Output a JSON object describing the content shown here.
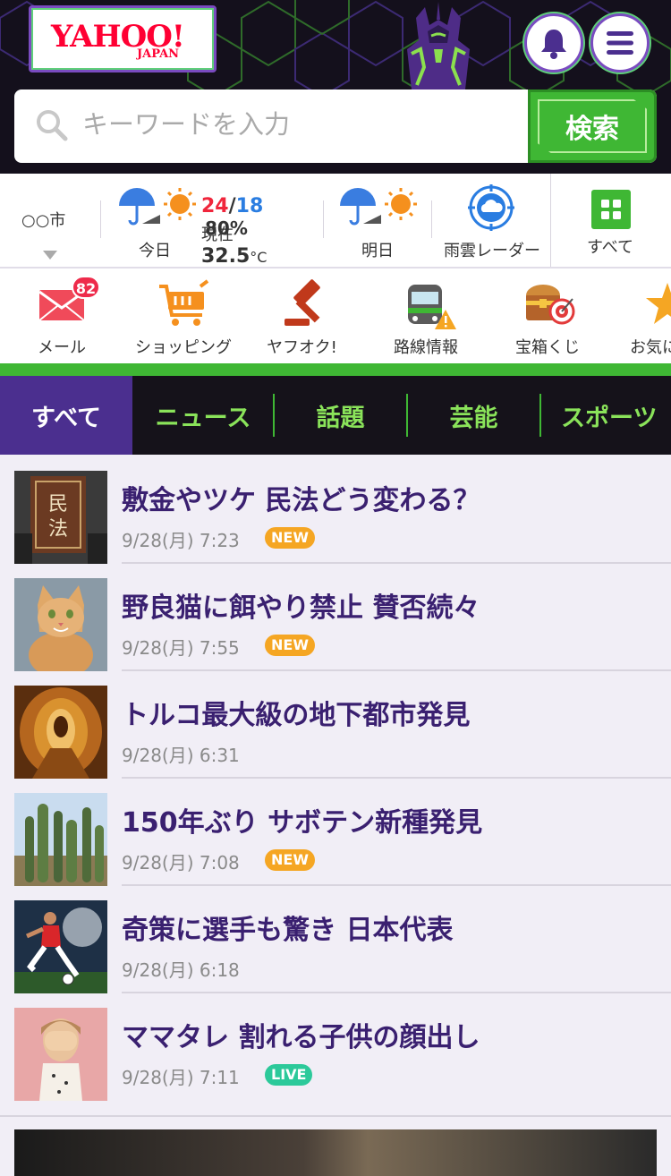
{
  "header": {
    "logo_text": "YAHOO!",
    "logo_sub": "JAPAN",
    "search": {
      "placeholder": "キーワードを入力",
      "button": "検索"
    },
    "colors": {
      "accent": "#4b2f8f",
      "green": "#3fb734"
    }
  },
  "weather": {
    "city": "○○市",
    "today": {
      "label": "今日",
      "high": "24",
      "slash": "/",
      "low": "18",
      "rain": "80%",
      "current_label": "現在",
      "current_temp": "32.5",
      "current_unit": "°C"
    },
    "tomorrow": {
      "label": "明日"
    },
    "radar_label": "雨雲レーダー",
    "all_label": "すべて"
  },
  "services": [
    {
      "label": "メール",
      "badge": "82",
      "icon": "mail-icon"
    },
    {
      "label": "ショッピング",
      "icon": "cart-icon"
    },
    {
      "label": "ヤフオク!",
      "icon": "auction-hammer-icon"
    },
    {
      "label": "路線情報",
      "icon": "train-icon"
    },
    {
      "label": "宝箱くじ",
      "icon": "treasure-icon"
    },
    {
      "label": "お気に",
      "icon": "star-icon"
    }
  ],
  "tabs": [
    "すべて",
    "ニュース",
    "話題",
    "芸能",
    "スポーツ"
  ],
  "news": [
    {
      "title": "敷金やツケ 民法どう変わる？",
      "time": "9/28(月) 7:23",
      "tag": "NEW"
    },
    {
      "title": "野良猫に餌やり禁止 賛否続々",
      "time": "9/28(月) 7:55",
      "tag": "NEW"
    },
    {
      "title": "トルコ最大級の地下都市発見",
      "time": "9/28(月) 6:31",
      "tag": ""
    },
    {
      "title": "150年ぶり サボテン新種発見",
      "time": "9/28(月) 7:08",
      "tag": "NEW"
    },
    {
      "title": "奇策に選手も驚き 日本代表",
      "time": "9/28(月) 6:18",
      "tag": ""
    },
    {
      "title": "ママタレ 割れる子供の顔出し",
      "time": "9/28(月) 7:11",
      "tag": "LIVE"
    }
  ]
}
